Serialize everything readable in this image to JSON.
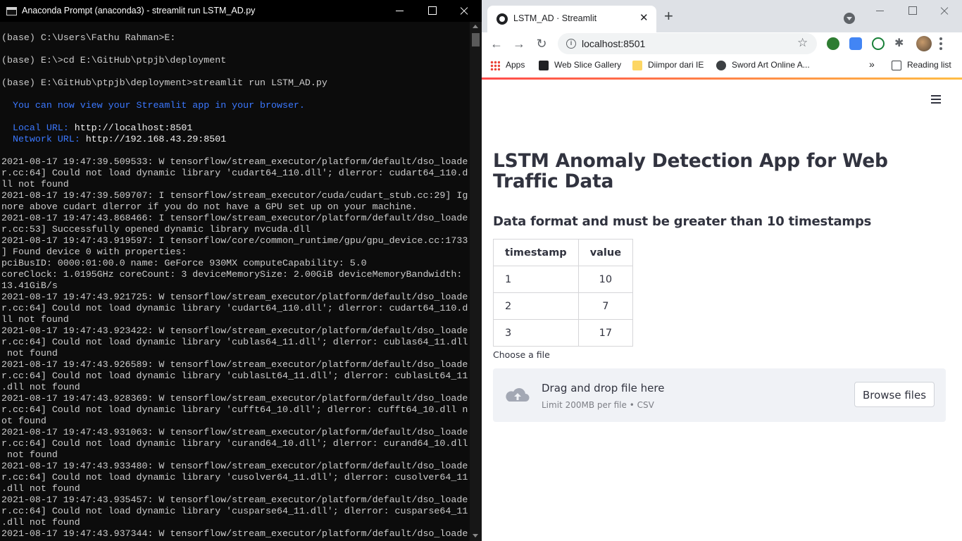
{
  "terminal": {
    "title": "Anaconda Prompt (anaconda3) - streamlit  run LSTM_AD.py",
    "lines": [
      {
        "text": "(base) C:\\Users\\Fathu Rahman>E:",
        "color": "default"
      },
      {
        "text": "",
        "color": "default"
      },
      {
        "text": "(base) E:\\>cd E:\\GitHub\\ptpjb\\deployment",
        "color": "default"
      },
      {
        "text": "",
        "color": "default"
      },
      {
        "text": "(base) E:\\GitHub\\ptpjb\\deployment>streamlit run LSTM_AD.py",
        "color": "default"
      },
      {
        "text": "",
        "color": "default"
      },
      {
        "text": "  You can now view your Streamlit app in your browser.",
        "color": "blue"
      },
      {
        "text": "",
        "color": "default"
      },
      {
        "text": "  Local URL: http://localhost:8501",
        "color": "url"
      },
      {
        "text": "  Network URL: http://192.168.43.29:8501",
        "color": "url"
      },
      {
        "text": "",
        "color": "default"
      },
      {
        "text": "2021-08-17 19:47:39.509533: W tensorflow/stream_executor/platform/default/dso_loade",
        "color": "default"
      },
      {
        "text": "r.cc:64] Could not load dynamic library 'cudart64_110.dll'; dlerror: cudart64_110.d",
        "color": "default"
      },
      {
        "text": "ll not found",
        "color": "default"
      },
      {
        "text": "2021-08-17 19:47:39.509707: I tensorflow/stream_executor/cuda/cudart_stub.cc:29] Ig",
        "color": "default"
      },
      {
        "text": "nore above cudart dlerror if you do not have a GPU set up on your machine.",
        "color": "default"
      },
      {
        "text": "2021-08-17 19:47:43.868466: I tensorflow/stream_executor/platform/default/dso_loade",
        "color": "default"
      },
      {
        "text": "r.cc:53] Successfully opened dynamic library nvcuda.dll",
        "color": "default"
      },
      {
        "text": "2021-08-17 19:47:43.919597: I tensorflow/core/common_runtime/gpu/gpu_device.cc:1733",
        "color": "default"
      },
      {
        "text": "] Found device 0 with properties:",
        "color": "default"
      },
      {
        "text": "pciBusID: 0000:01:00.0 name: GeForce 930MX computeCapability: 5.0",
        "color": "default"
      },
      {
        "text": "coreClock: 1.0195GHz coreCount: 3 deviceMemorySize: 2.00GiB deviceMemoryBandwidth:",
        "color": "default"
      },
      {
        "text": "13.41GiB/s",
        "color": "default"
      },
      {
        "text": "2021-08-17 19:47:43.921725: W tensorflow/stream_executor/platform/default/dso_loade",
        "color": "default"
      },
      {
        "text": "r.cc:64] Could not load dynamic library 'cudart64_110.dll'; dlerror: cudart64_110.d",
        "color": "default"
      },
      {
        "text": "ll not found",
        "color": "default"
      },
      {
        "text": "2021-08-17 19:47:43.923422: W tensorflow/stream_executor/platform/default/dso_loade",
        "color": "default"
      },
      {
        "text": "r.cc:64] Could not load dynamic library 'cublas64_11.dll'; dlerror: cublas64_11.dll",
        "color": "default"
      },
      {
        "text": " not found",
        "color": "default"
      },
      {
        "text": "2021-08-17 19:47:43.926589: W tensorflow/stream_executor/platform/default/dso_loade",
        "color": "default"
      },
      {
        "text": "r.cc:64] Could not load dynamic library 'cublasLt64_11.dll'; dlerror: cublasLt64_11",
        "color": "default"
      },
      {
        "text": ".dll not found",
        "color": "default"
      },
      {
        "text": "2021-08-17 19:47:43.928369: W tensorflow/stream_executor/platform/default/dso_loade",
        "color": "default"
      },
      {
        "text": "r.cc:64] Could not load dynamic library 'cufft64_10.dll'; dlerror: cufft64_10.dll n",
        "color": "default"
      },
      {
        "text": "ot found",
        "color": "default"
      },
      {
        "text": "2021-08-17 19:47:43.931063: W tensorflow/stream_executor/platform/default/dso_loade",
        "color": "default"
      },
      {
        "text": "r.cc:64] Could not load dynamic library 'curand64_10.dll'; dlerror: curand64_10.dll",
        "color": "default"
      },
      {
        "text": " not found",
        "color": "default"
      },
      {
        "text": "2021-08-17 19:47:43.933480: W tensorflow/stream_executor/platform/default/dso_loade",
        "color": "default"
      },
      {
        "text": "r.cc:64] Could not load dynamic library 'cusolver64_11.dll'; dlerror: cusolver64_11",
        "color": "default"
      },
      {
        "text": ".dll not found",
        "color": "default"
      },
      {
        "text": "2021-08-17 19:47:43.935457: W tensorflow/stream_executor/platform/default/dso_loade",
        "color": "default"
      },
      {
        "text": "r.cc:64] Could not load dynamic library 'cusparse64_11.dll'; dlerror: cusparse64_11",
        "color": "default"
      },
      {
        "text": ".dll not found",
        "color": "default"
      },
      {
        "text": "2021-08-17 19:47:43.937344: W tensorflow/stream_executor/platform/default/dso_loade",
        "color": "default"
      }
    ]
  },
  "browser": {
    "tab_title": "LSTM_AD · Streamlit",
    "url": "localhost:8501",
    "bookmarks": {
      "apps": "Apps",
      "web_slice": "Web Slice Gallery",
      "diimpor": "Diimpor dari IE",
      "sao": "Sword Art Online A...",
      "more": "»",
      "reading_list": "Reading list"
    }
  },
  "app": {
    "title": "LSTM Anomaly Detection App for Web Traffic Data",
    "subheader": "Data format and must be greater than 10 timestamps",
    "table": {
      "headers": [
        "timestamp",
        "value"
      ],
      "rows": [
        [
          "1",
          "10"
        ],
        [
          "2",
          "7"
        ],
        [
          "3",
          "17"
        ]
      ]
    },
    "uploader": {
      "label": "Choose a file",
      "drop_title": "Drag and drop file here",
      "limit": "Limit 200MB per file • CSV",
      "browse": "Browse files"
    }
  },
  "colors": {
    "terminal_bg": "#0c0c0c",
    "terminal_blue": "#3b78ff",
    "streamlit_text": "#31333f",
    "dropzone_bg": "#f0f2f6"
  }
}
